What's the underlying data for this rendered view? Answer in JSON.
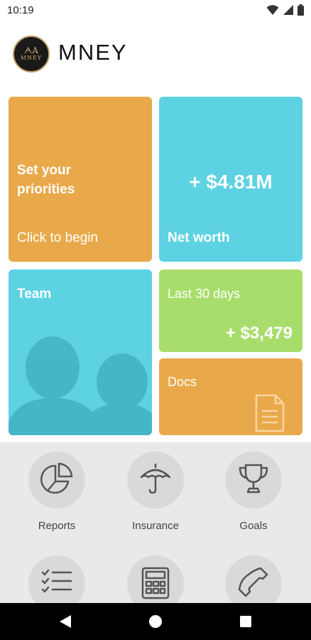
{
  "status_bar": {
    "time": "10:19",
    "icons": [
      "wifi-icon",
      "signal-icon",
      "battery-icon"
    ]
  },
  "header": {
    "logo_monogram": "ᗅA",
    "logo_text": "MNEY",
    "title": "MNEY"
  },
  "tiles": {
    "priorities": {
      "heading_line1": "Set your",
      "heading_line2": "priorities",
      "action": "Click to begin",
      "color": "#e9a94a"
    },
    "net_worth": {
      "value": "+ $4.81M",
      "label": "Net worth",
      "color": "#5cd2e2"
    },
    "team": {
      "label": "Team",
      "icon": "people-silhouette-icon",
      "color": "#5cd2e2"
    },
    "last_30_days": {
      "label": "Last 30 days",
      "value": "+ $3,479",
      "color": "#a8dd6b"
    },
    "docs": {
      "label": "Docs",
      "icon": "document-icon",
      "color": "#e9a94a"
    }
  },
  "menu": {
    "items": [
      {
        "label": "Reports",
        "icon": "pie-chart-icon"
      },
      {
        "label": "Insurance",
        "icon": "umbrella-icon"
      },
      {
        "label": "Goals",
        "icon": "trophy-icon"
      },
      {
        "label": "",
        "icon": "checklist-icon"
      },
      {
        "label": "",
        "icon": "calculator-icon"
      },
      {
        "label": "",
        "icon": "phone-icon"
      }
    ]
  },
  "nav": {
    "buttons": [
      "back-icon",
      "home-icon",
      "recents-icon"
    ]
  }
}
